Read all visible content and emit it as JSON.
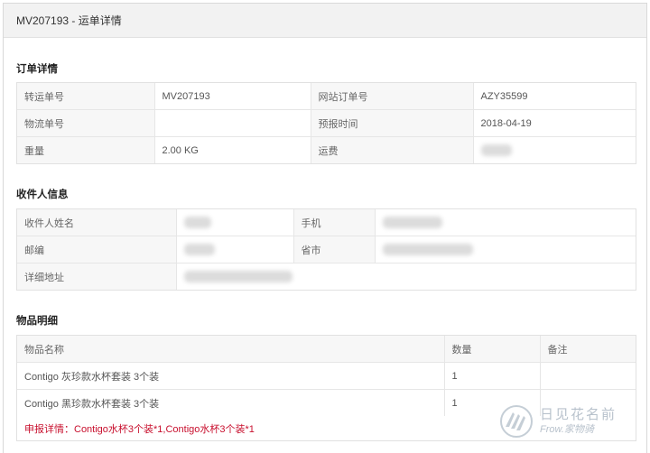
{
  "window": {
    "title": "MV207193 - 运单详情"
  },
  "order_details": {
    "title": "订单详情",
    "rows": [
      {
        "label1": "转运单号",
        "value1": "MV207193",
        "label2": "网站订单号",
        "value2": "AZY35599"
      },
      {
        "label1": "物流单号",
        "value1": "",
        "label2": "预报时间",
        "value2": "2018-04-19"
      },
      {
        "label1": "重量",
        "value1": "2.00 KG",
        "label2": "运费",
        "value2": ""
      }
    ]
  },
  "recipient": {
    "title": "收件人信息",
    "labels": {
      "name": "收件人姓名",
      "phone": "手机",
      "postcode": "邮编",
      "province_city": "省市",
      "address": "详细地址"
    }
  },
  "items": {
    "title": "物品明细",
    "columns": [
      "物品名称",
      "数量",
      "备注"
    ],
    "rows": [
      {
        "name": "Contigo 灰珍款水杯套装 3个装",
        "qty": "1",
        "note": ""
      },
      {
        "name": "Contigo 黑珍款水杯套装 3个装",
        "qty": "1",
        "note": ""
      }
    ],
    "declaration": "申报详情：Contigo水杯3个装*1,Contigo水杯3个装*1"
  },
  "watermark": {
    "line1": "日见花名前",
    "line2": "Frow.家物骑",
    "logo_icon": "wings-logo"
  },
  "colors": {
    "header_bg": "#f2f2f2",
    "label_bg": "#f7f7f7",
    "declaration_red": "#c8102e"
  }
}
